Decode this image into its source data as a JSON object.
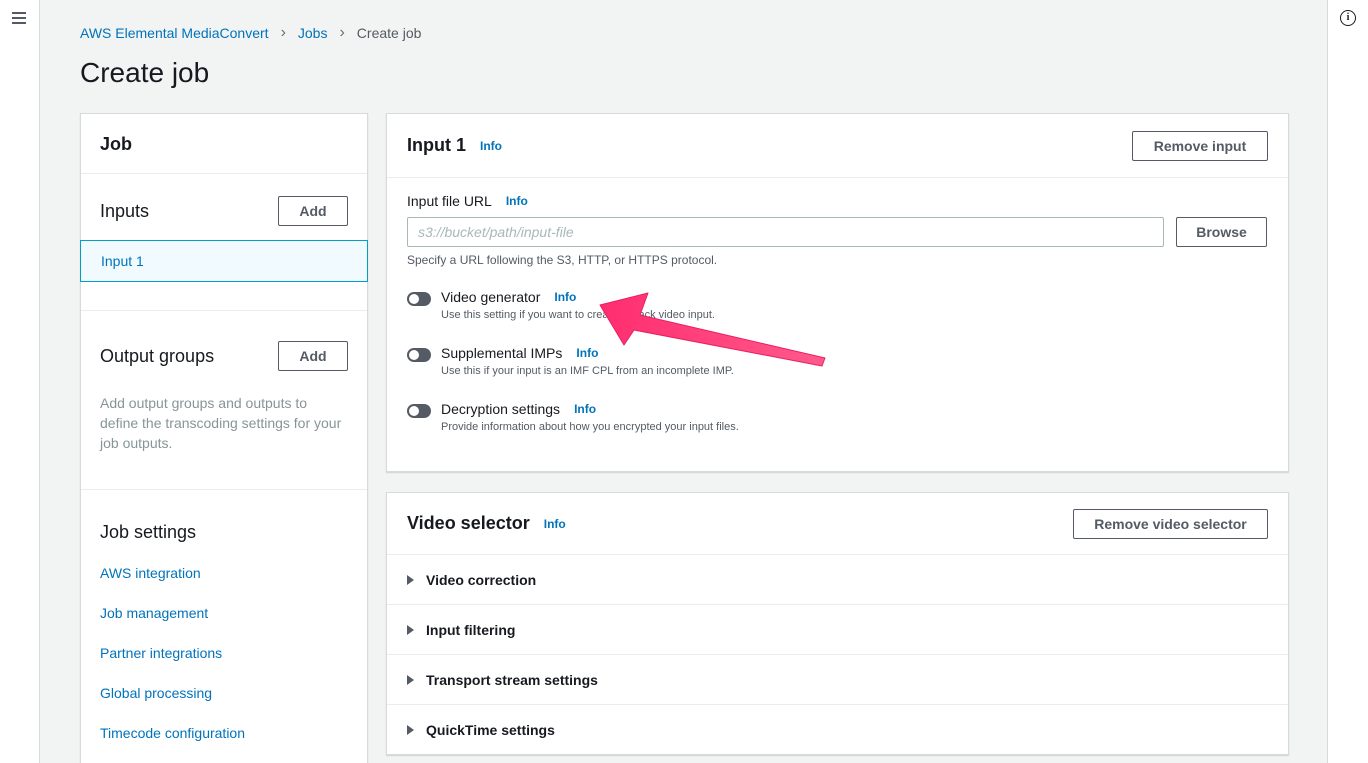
{
  "breadcrumb": {
    "root": "AWS Elemental MediaConvert",
    "jobs": "Jobs",
    "current": "Create job"
  },
  "page_title": "Create job",
  "nav": {
    "job_header": "Job",
    "inputs_title": "Inputs",
    "inputs_add": "Add",
    "input_item": "Input 1",
    "output_groups_title": "Output groups",
    "output_groups_add": "Add",
    "output_groups_desc": "Add output groups and outputs to define the transcoding settings for your job outputs.",
    "job_settings_title": "Job settings",
    "job_settings_links": [
      "AWS integration",
      "Job management",
      "Partner integrations",
      "Global processing",
      "Timecode configuration"
    ]
  },
  "input_panel": {
    "title": "Input 1",
    "info": "Info",
    "remove_button": "Remove input",
    "url_label": "Input file URL",
    "url_info": "Info",
    "url_placeholder": "s3://bucket/path/input-file",
    "browse_button": "Browse",
    "url_hint": "Specify a URL following the S3, HTTP, or HTTPS protocol.",
    "toggles": [
      {
        "label": "Video generator",
        "info": "Info",
        "desc": "Use this setting if you want to create a black video input.",
        "enabled": false
      },
      {
        "label": "Supplemental IMPs",
        "info": "Info",
        "desc": "Use this if your input is an IMF CPL from an incomplete IMP.",
        "enabled": false
      },
      {
        "label": "Decryption settings",
        "info": "Info",
        "desc": "Provide information about how you encrypted your input files.",
        "enabled": false
      }
    ]
  },
  "video_selector_panel": {
    "title": "Video selector",
    "info": "Info",
    "remove_button": "Remove video selector",
    "sections": [
      "Video correction",
      "Input filtering",
      "Transport stream settings",
      "QuickTime settings"
    ]
  },
  "colors": {
    "link": "#0073bb",
    "annotation_arrow": "#ff3d7f",
    "background": "#f2f3f3"
  }
}
